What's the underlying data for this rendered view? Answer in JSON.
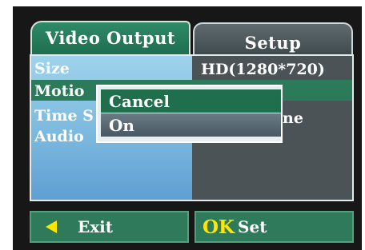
{
  "tabs": [
    {
      "label": "Video Output"
    },
    {
      "label": "Setup"
    }
  ],
  "menu": {
    "rows": [
      {
        "label": "Size",
        "value": "HD(1280*720)"
      },
      {
        "label": "Motion",
        "shown_label": "Motio"
      },
      {
        "label": "Time S",
        "shown_value": "ne"
      },
      {
        "label": "Audio"
      }
    ]
  },
  "popup": {
    "options": [
      "Cancel",
      "On"
    ],
    "selected": "Cancel"
  },
  "bottom": {
    "exit_label": "Exit",
    "ok_icon_text": "OK",
    "set_label": "Set"
  },
  "colors": {
    "accent_green": "#2f7a5b",
    "selection_green": "#1f6e4c",
    "menu_blue": "#78b6dd",
    "icon_yellow": "#ffe600",
    "panel_gray": "#4b5356"
  }
}
